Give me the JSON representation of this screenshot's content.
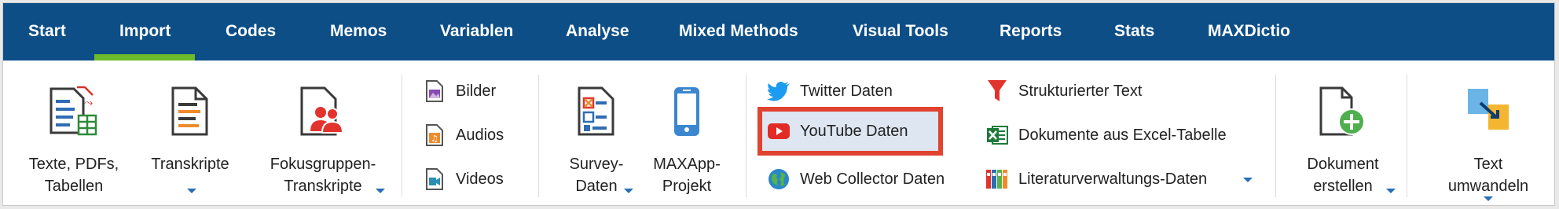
{
  "menu": {
    "tabs": [
      "Start",
      "Import",
      "Codes",
      "Memos",
      "Variablen",
      "Analyse",
      "Mixed Methods",
      "Visual Tools",
      "Reports",
      "Stats",
      "MAXDictio"
    ],
    "active_tab": "Import",
    "active_color": "#6dbb2a",
    "bar_color": "#0d4e87"
  },
  "ribbon": {
    "texte": {
      "line1": "Texte, PDFs,",
      "line2": "Tabellen"
    },
    "transkripte": {
      "line1": "Transkripte"
    },
    "fokus": {
      "line1": "Fokusgruppen-",
      "line2": "Transkripte"
    },
    "bilder": "Bilder",
    "audios": "Audios",
    "videos": "Videos",
    "survey": {
      "line1": "Survey-",
      "line2": "Daten"
    },
    "maxapp": {
      "line1": "MAXApp-",
      "line2": "Projekt"
    },
    "twitter": "Twitter Daten",
    "youtube": "YouTube Daten",
    "webcollector": "Web Collector Daten",
    "strukturiert": "Strukturierter Text",
    "excel": "Dokumente aus Excel-Tabelle",
    "literatur": "Literaturverwaltungs-Daten",
    "dokument": {
      "line1": "Dokument",
      "line2": "erstellen"
    },
    "text_umwandeln": {
      "line1": "Text",
      "line2": "umwandeln"
    },
    "highlight_color": "#e0432f"
  }
}
